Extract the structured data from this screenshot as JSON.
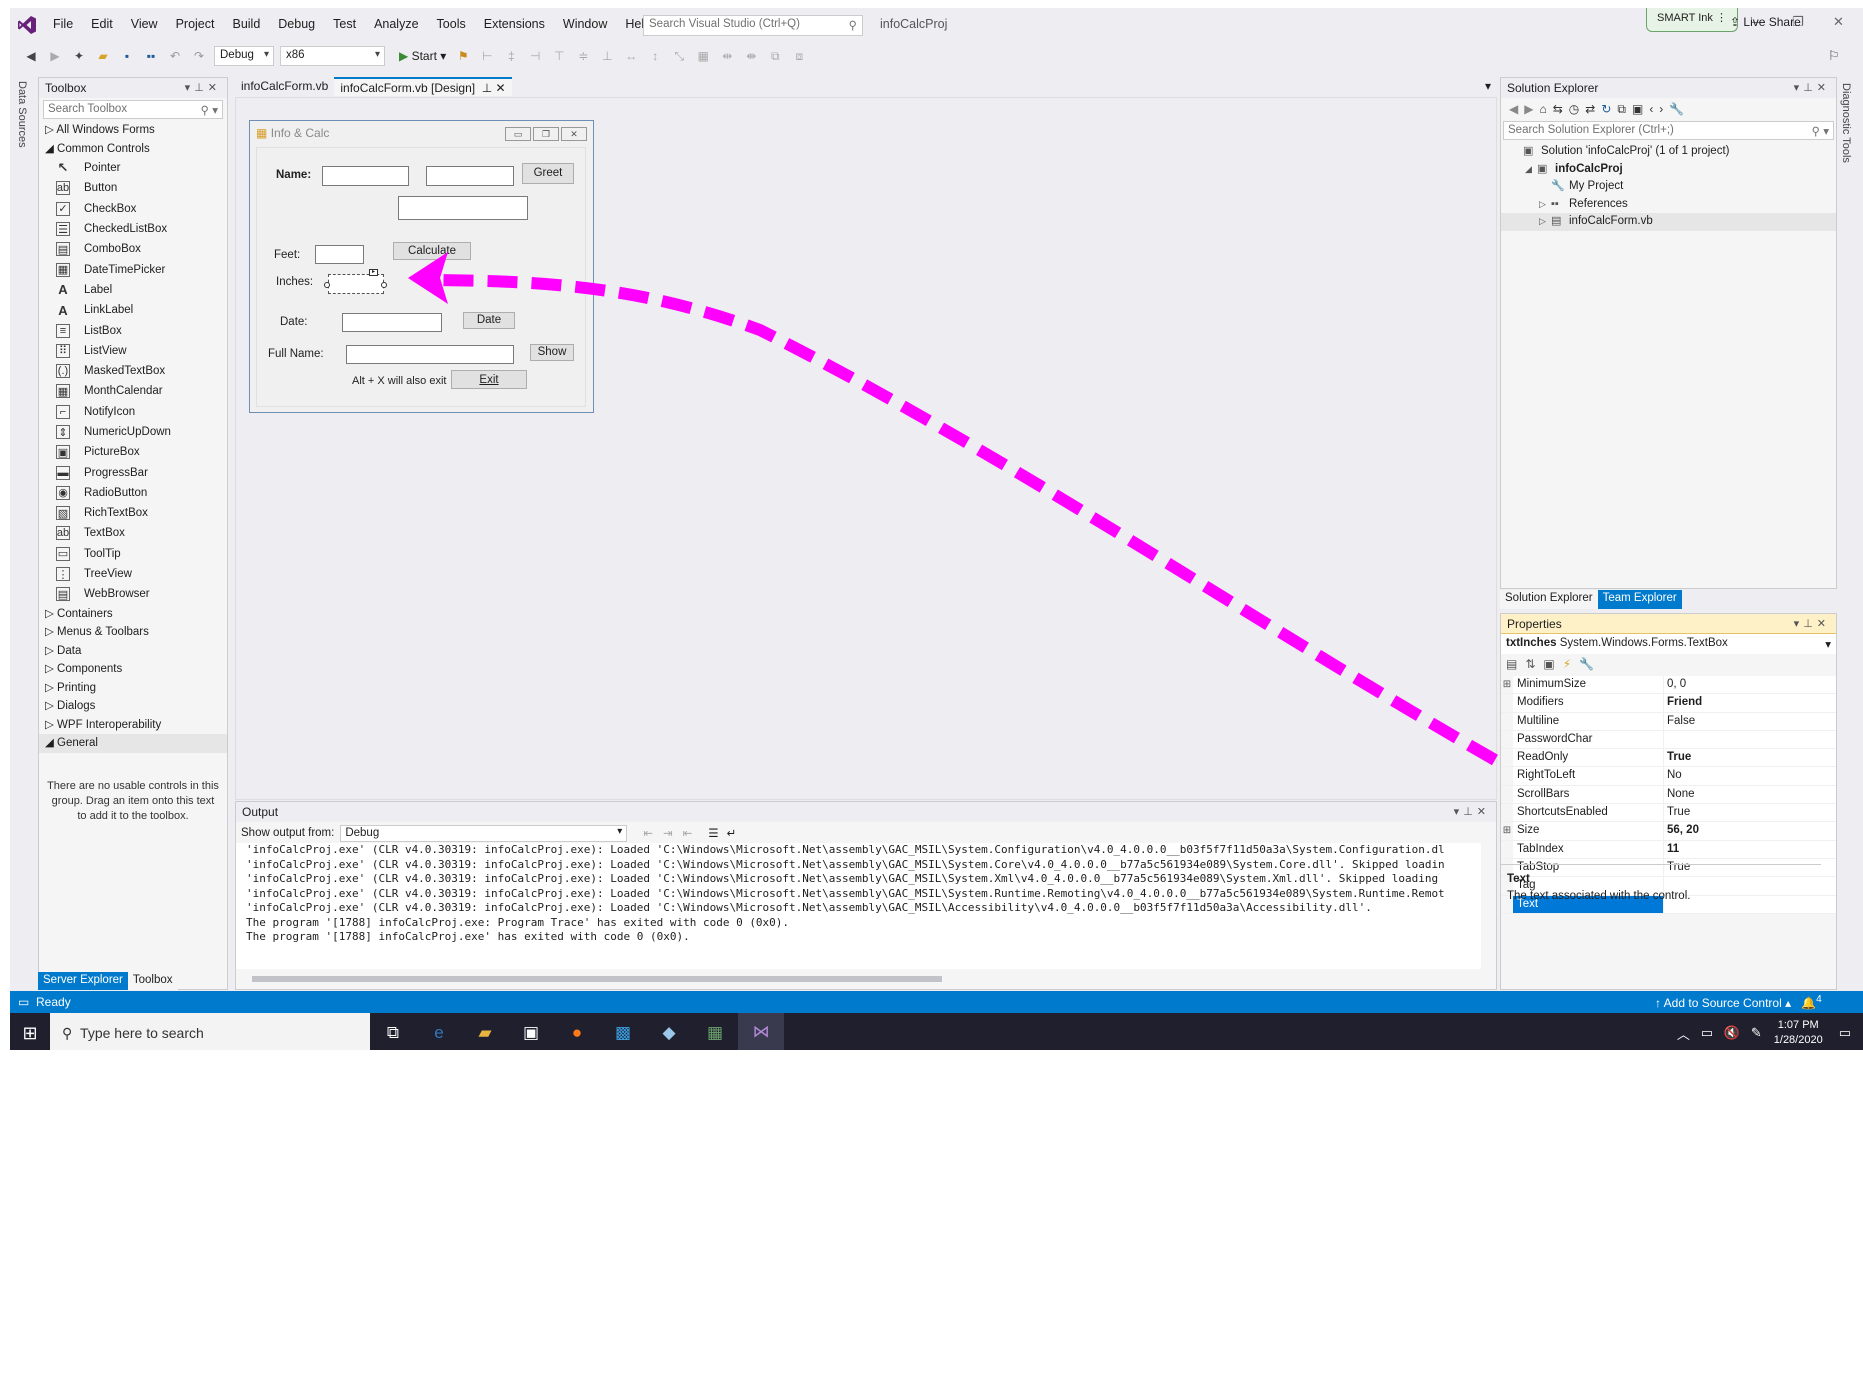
{
  "menubar": {
    "items": [
      "File",
      "Edit",
      "View",
      "Project",
      "Build",
      "Debug",
      "Test",
      "Analyze",
      "Tools",
      "Extensions",
      "Window",
      "Help"
    ],
    "search_placeholder": "Search Visual Studio (Ctrl+Q)",
    "project_name": "infoCalcProj",
    "smart_ink": "SMART Ink"
  },
  "toolbar": {
    "config": "Debug",
    "platform": "x86",
    "start_label": "Start",
    "live_share": "Live Share"
  },
  "left_strip": {
    "label": "Data Sources"
  },
  "right_strip": {
    "label": "Diagnostic Tools"
  },
  "toolbox": {
    "title": "Toolbox",
    "search_placeholder": "Search Toolbox",
    "group_all": "All Windows Forms",
    "group_common": "Common Controls",
    "items": [
      {
        "label": "Pointer",
        "icon": "pointer-icon",
        "glyph": "↖"
      },
      {
        "label": "Button",
        "icon": "button-icon",
        "glyph": "ab"
      },
      {
        "label": "CheckBox",
        "icon": "checkbox-icon",
        "glyph": "✓"
      },
      {
        "label": "CheckedListBox",
        "icon": "checkedlistbox-icon",
        "glyph": "☰"
      },
      {
        "label": "ComboBox",
        "icon": "combobox-icon",
        "glyph": "▤"
      },
      {
        "label": "DateTimePicker",
        "icon": "datetimepicker-icon",
        "glyph": "▦"
      },
      {
        "label": "Label",
        "icon": "label-icon",
        "glyph": "A"
      },
      {
        "label": "LinkLabel",
        "icon": "linklabel-icon",
        "glyph": "A"
      },
      {
        "label": "ListBox",
        "icon": "listbox-icon",
        "glyph": "≡"
      },
      {
        "label": "ListView",
        "icon": "listview-icon",
        "glyph": "⠿"
      },
      {
        "label": "MaskedTextBox",
        "icon": "maskedtextbox-icon",
        "glyph": "(.)"
      },
      {
        "label": "MonthCalendar",
        "icon": "monthcalendar-icon",
        "glyph": "▦"
      },
      {
        "label": "NotifyIcon",
        "icon": "notifyicon-icon",
        "glyph": "⌐"
      },
      {
        "label": "NumericUpDown",
        "icon": "numericupdown-icon",
        "glyph": "⇕"
      },
      {
        "label": "PictureBox",
        "icon": "picturebox-icon",
        "glyph": "▣"
      },
      {
        "label": "ProgressBar",
        "icon": "progressbar-icon",
        "glyph": "▬"
      },
      {
        "label": "RadioButton",
        "icon": "radiobutton-icon",
        "glyph": "◉"
      },
      {
        "label": "RichTextBox",
        "icon": "richtextbox-icon",
        "glyph": "▧"
      },
      {
        "label": "TextBox",
        "icon": "textbox-icon",
        "glyph": "ab"
      },
      {
        "label": "ToolTip",
        "icon": "tooltip-icon",
        "glyph": "▭"
      },
      {
        "label": "TreeView",
        "icon": "treeview-icon",
        "glyph": "⋮"
      },
      {
        "label": "WebBrowser",
        "icon": "webbrowser-icon",
        "glyph": "▤"
      }
    ],
    "collapsed_groups": [
      "Containers",
      "Menus & Toolbars",
      "Data",
      "Components",
      "Printing",
      "Dialogs",
      "WPF Interoperability"
    ],
    "group_general": "General",
    "note": "There are no usable controls in this group. Drag an item onto this text to add it to the toolbox.",
    "tabs": [
      "Server Explorer",
      "Toolbox"
    ]
  },
  "doc_tabs": [
    {
      "label": "infoCalcForm.vb",
      "active": false
    },
    {
      "label": "infoCalcForm.vb [Design]",
      "active": true
    }
  ],
  "form": {
    "title": "Info & Calc",
    "name_label": "Name:",
    "greet": "Greet",
    "feet_label": "Feet:",
    "calculate": "Calculate",
    "inches_label": "Inches:",
    "date_label": "Date:",
    "date_button": "Date",
    "fullname_label": "Full Name:",
    "show": "Show",
    "exit_hint": "Alt + X will also exit",
    "exit": "Exit"
  },
  "output": {
    "title": "Output",
    "show_from_label": "Show output from:",
    "source": "Debug",
    "lines": [
      "'infoCalcProj.exe' (CLR v4.0.30319: infoCalcProj.exe): Loaded 'C:\\Windows\\Microsoft.Net\\assembly\\GAC_MSIL\\System.Configuration\\v4.0_4.0.0.0__b03f5f7f11d50a3a\\System.Configuration.dl",
      "'infoCalcProj.exe' (CLR v4.0.30319: infoCalcProj.exe): Loaded 'C:\\Windows\\Microsoft.Net\\assembly\\GAC_MSIL\\System.Core\\v4.0_4.0.0.0__b77a5c561934e089\\System.Core.dll'. Skipped loadin",
      "'infoCalcProj.exe' (CLR v4.0.30319: infoCalcProj.exe): Loaded 'C:\\Windows\\Microsoft.Net\\assembly\\GAC_MSIL\\System.Xml\\v4.0_4.0.0.0__b77a5c561934e089\\System.Xml.dll'. Skipped loading",
      "'infoCalcProj.exe' (CLR v4.0.30319: infoCalcProj.exe): Loaded 'C:\\Windows\\Microsoft.Net\\assembly\\GAC_MSIL\\System.Runtime.Remoting\\v4.0_4.0.0.0__b77a5c561934e089\\System.Runtime.Remot",
      "'infoCalcProj.exe' (CLR v4.0.30319: infoCalcProj.exe): Loaded 'C:\\Windows\\Microsoft.Net\\assembly\\GAC_MSIL\\Accessibility\\v4.0_4.0.0.0__b03f5f7f11d50a3a\\Accessibility.dll'.",
      "The program '[1788] infoCalcProj.exe: Program Trace' has exited with code 0 (0x0).",
      "The program '[1788] infoCalcProj.exe' has exited with code 0 (0x0)."
    ]
  },
  "solution": {
    "title": "Solution Explorer",
    "search_placeholder": "Search Solution Explorer (Ctrl+;)",
    "tree": [
      {
        "label": "Solution 'infoCalcProj' (1 of 1 project)",
        "indent": 0,
        "exp": "",
        "icon": "▣",
        "bold": false
      },
      {
        "label": "infoCalcProj",
        "indent": 1,
        "exp": "◢",
        "icon": "▣",
        "bold": true
      },
      {
        "label": "My Project",
        "indent": 2,
        "exp": "",
        "icon": "🔧",
        "bold": false
      },
      {
        "label": "References",
        "indent": 2,
        "exp": "▷",
        "icon": "▪▪",
        "bold": false
      },
      {
        "label": "infoCalcForm.vb",
        "indent": 2,
        "exp": "▷",
        "icon": "▤",
        "bold": false
      }
    ],
    "tabs": [
      "Solution Explorer",
      "Team Explorer"
    ]
  },
  "properties": {
    "title": "Properties",
    "object_name": "txtInches",
    "object_type": "System.Windows.Forms.TextBox",
    "rows": [
      {
        "name": "MinimumSize",
        "value": "0, 0",
        "exp": "⊞",
        "bold": false
      },
      {
        "name": "Modifiers",
        "value": "Friend",
        "exp": "",
        "bold": true
      },
      {
        "name": "Multiline",
        "value": "False",
        "exp": "",
        "bold": false
      },
      {
        "name": "PasswordChar",
        "value": "",
        "exp": "",
        "bold": false
      },
      {
        "name": "ReadOnly",
        "value": "True",
        "exp": "",
        "bold": true
      },
      {
        "name": "RightToLeft",
        "value": "No",
        "exp": "",
        "bold": false
      },
      {
        "name": "ScrollBars",
        "value": "None",
        "exp": "",
        "bold": false
      },
      {
        "name": "ShortcutsEnabled",
        "value": "True",
        "exp": "",
        "bold": false
      },
      {
        "name": "Size",
        "value": "56, 20",
        "exp": "⊞",
        "bold": true
      },
      {
        "name": "TabIndex",
        "value": "11",
        "exp": "",
        "bold": true
      },
      {
        "name": "TabStop",
        "value": "True",
        "exp": "",
        "bold": false
      },
      {
        "name": "Tag",
        "value": "",
        "exp": "",
        "bold": false
      },
      {
        "name": "Text",
        "value": "",
        "exp": "",
        "bold": false,
        "selected": true
      }
    ],
    "desc_title": "Text",
    "desc_text": "The text associated with the control."
  },
  "statusbar": {
    "text": "Ready",
    "source_control": "Add to Source Control",
    "notifications": "4"
  },
  "taskbar": {
    "search_placeholder": "Type here to search",
    "time": "1:07 PM",
    "date": "1/28/2020"
  },
  "colors": {
    "accent": "#007acc",
    "annotation_arrow": "#ff00ff",
    "properties_header": "#fff1c7"
  }
}
